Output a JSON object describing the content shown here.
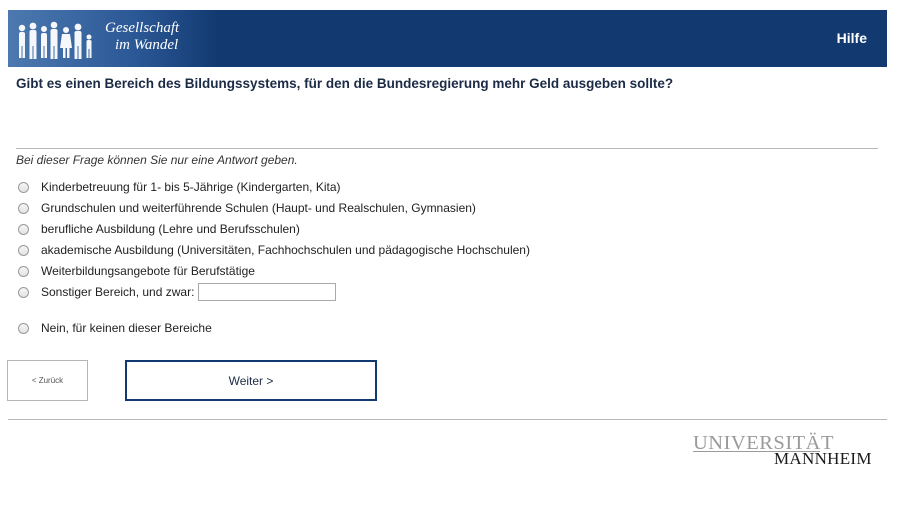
{
  "header": {
    "logo_line1": "Gesellschaft",
    "logo_line2": "im Wandel",
    "help_label": "Hilfe",
    "background_color": "#123a71"
  },
  "question": {
    "text": "Gibt es einen Bereich des Bildungssystems, für den die Bundesregierung mehr Geld ausgeben sollte?",
    "instruction": "Bei dieser Frage können Sie nur eine Antwort geben.",
    "options": [
      {
        "label": "Kinderbetreuung für 1- bis 5-Jährige (Kindergarten, Kita)"
      },
      {
        "label": "Grundschulen und weiterführende Schulen (Haupt- und Realschulen, Gymnasien)"
      },
      {
        "label": "berufliche Ausbildung (Lehre und Berufsschulen)"
      },
      {
        "label": "akademische Ausbildung (Universitäten, Fachhochschulen und pädagogische Hochschulen)"
      },
      {
        "label": "Weiterbildungsangebote für Berufstätige"
      },
      {
        "label": "Sonstiger Bereich, und zwar:",
        "input_value": ""
      },
      {
        "label": "Nein, für keinen dieser Bereiche"
      }
    ],
    "selected_index": null
  },
  "navigation": {
    "back_label": "< Zurück",
    "next_label": "Weiter >"
  },
  "footer": {
    "university_line1": "UNIVERSITÄT",
    "university_line2": "MANNHEIM"
  }
}
